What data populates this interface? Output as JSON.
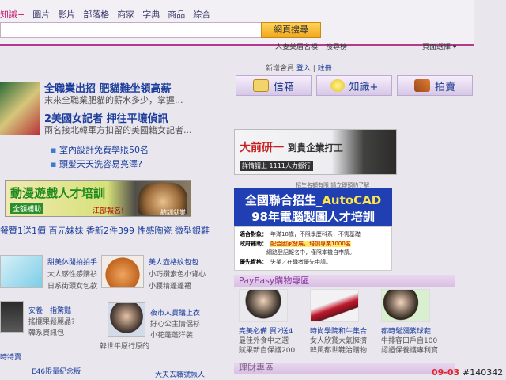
{
  "search": {
    "tabs": [
      "知識+",
      "圖片",
      "影片",
      "部落格",
      "商家",
      "字典",
      "商品",
      "綜合"
    ],
    "button": "網頁搜尋",
    "util_links": [
      "人妻美眉名模",
      "搜尋榜"
    ],
    "util_right": "頁面選擇"
  },
  "member": {
    "prefix": "新增會員",
    "login": "登入",
    "register": "註冊"
  },
  "quicklinks": [
    "信箱",
    "知識+",
    "拍賣"
  ],
  "news": {
    "h1": "全職業出招 肥貓難坐領高薪",
    "h1_sub": "末來全職業肥貓的薪水多少，掌握...",
    "h2": "2美國女記者 押往平壤偵訊",
    "h2_sub": "兩名接北韓軍方扣留的美國籍女記者...",
    "b1": "室內設計免費學賬50名",
    "b2": "頭髮天天洗容易亮澤?"
  },
  "banner1": {
    "title": "動漫遊戲人才培訓",
    "tag": "全額補助",
    "deadline": "江部報名!",
    "caption": "結訓就業"
  },
  "promo_line": "餐贊1送1價 百元妹妹 香新2件399 性感陶瓷 微型銀鞋",
  "grid": [
    {
      "t1": "甜美休閒拍拍手",
      "t2": "大人感性感購衫",
      "t3": "日系街頭女包款"
    },
    {
      "t1": "美人壺格紋包包",
      "t2": "小巧鑽素色小背心",
      "t3": "小腰精蓬蓬裙"
    },
    {
      "t1": "安養一指驚豔",
      "t2": "搖擺果鬆麗晶?",
      "t3": "韓系資訊包"
    },
    {
      "t1": "夜市人貨購上衣",
      "t2": "好心公主情侶衫",
      "t3": "小花蓬蓬洋裝"
    }
  ],
  "grid_extra": [
    "時特賣",
    "E46限量紀念版",
    "大夫去職號帳人",
    "韓世平原行原的"
  ],
  "ad1": {
    "title": "大前研一",
    "right": "到貴企業打工",
    "tag": "詳情請上 1111人力銀行"
  },
  "ad_notes": "招生名額有限 請立即預約了解",
  "ad2": {
    "line1_a": "全國聯合招生_",
    "line1_b": "AutoCAD",
    "line2": "98年電腦製圖人才培訓"
  },
  "ad2_rows": [
    {
      "k": "適合對象：",
      "v": "年滿18歲，不限學歷科系，不需基礎"
    },
    {
      "k": "政府補助：",
      "v": "配合國家發展，培訓專業1000名",
      "hl": true
    },
    {
      "k": "",
      "v": "網路登記報名中，僅限本機自申請。"
    },
    {
      "k": "優先資格：",
      "v": "失業／在職者優先申請。"
    }
  ],
  "payeasy": "PayEasy購物專區",
  "shop": [
    {
      "l1": "完美必備 買2送4",
      "l2": "最佳外食中之選",
      "l3": "賦果新自保護200"
    },
    {
      "l1": "時尚學院和牛集合",
      "l2": "女人欣賞大氣擁擠",
      "l3": "韓風都世鞋治購物"
    },
    {
      "l1": "都時髦瀰紫球鞋",
      "l2": "牛排客口戶自100",
      "l3": "認證保養護專利寶"
    }
  ],
  "bottom": "理財專區",
  "stamp": {
    "date": "09-03",
    "id": "#140342"
  },
  "colors": {
    "accent": "#b23b8e",
    "link": "#1a3c9a",
    "ad_blue": "#1f3fb3"
  }
}
